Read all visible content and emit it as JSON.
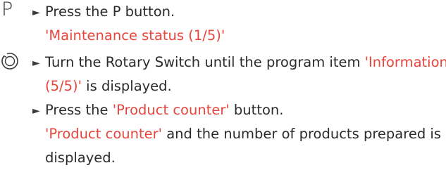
{
  "colors": {
    "text": "#2b2b2b",
    "highlight": "#e8453c"
  },
  "icons": {
    "step1": "P",
    "step2": "rotary-switch-icon"
  },
  "steps": [
    {
      "symbol": "P",
      "bullet": "►",
      "instruction": "Press the P button.",
      "result": "'Maintenance status (1/5)'"
    },
    {
      "bullet": "►",
      "instruction_pre": "Turn the Rotary Switch until the program item ",
      "instruction_hl_1": "'Information",
      "instruction_hl_2": "(5/5)'",
      "instruction_post": " is displayed."
    },
    {
      "bullet": "►",
      "instruction_pre": "Press the ",
      "instruction_hl": "'Product counter'",
      "instruction_post": " button.",
      "result_hl": "'Product counter'",
      "result_post_1": " and the number of products prepared is",
      "result_post_2": "displayed."
    }
  ]
}
